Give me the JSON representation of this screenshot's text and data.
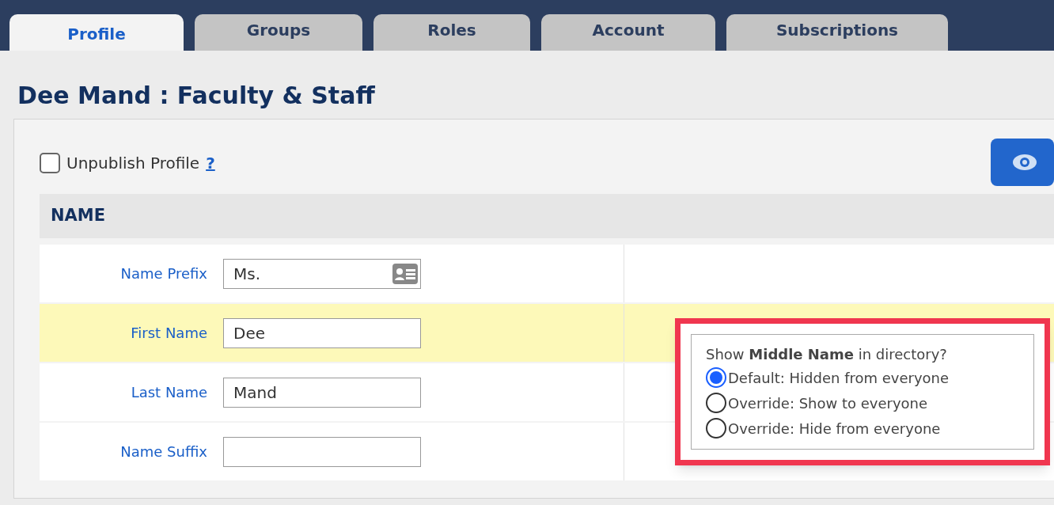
{
  "tabs": [
    {
      "label": "Profile",
      "selected": true
    },
    {
      "label": "Groups",
      "selected": false
    },
    {
      "label": "Roles",
      "selected": false
    },
    {
      "label": "Account",
      "selected": false
    },
    {
      "label": "Subscriptions",
      "selected": false
    }
  ],
  "page_title": "Dee Mand : Faculty & Staff",
  "unpublish": {
    "label": "Unpublish Profile",
    "checked": false,
    "help": "?"
  },
  "section": {
    "title": "NAME"
  },
  "fields": [
    {
      "label": "Name Prefix",
      "value": "Ms.",
      "highlighted": false,
      "card_icon": true
    },
    {
      "label": "First Name",
      "value": "Dee",
      "highlighted": true,
      "card_icon": false
    },
    {
      "label": "Last Name",
      "value": "Mand",
      "highlighted": false,
      "card_icon": false
    },
    {
      "label": "Name Suffix",
      "highlighted": false,
      "card_icon": false
    }
  ],
  "popup": {
    "question": "Show **Middle Name** in directory?",
    "options": [
      {
        "label": "Default: Hidden from everyone",
        "selected": true
      },
      {
        "label": "Override: Show to everyone",
        "selected": false
      },
      {
        "label": "Override: Hide from everyone",
        "selected": false
      }
    ]
  }
}
